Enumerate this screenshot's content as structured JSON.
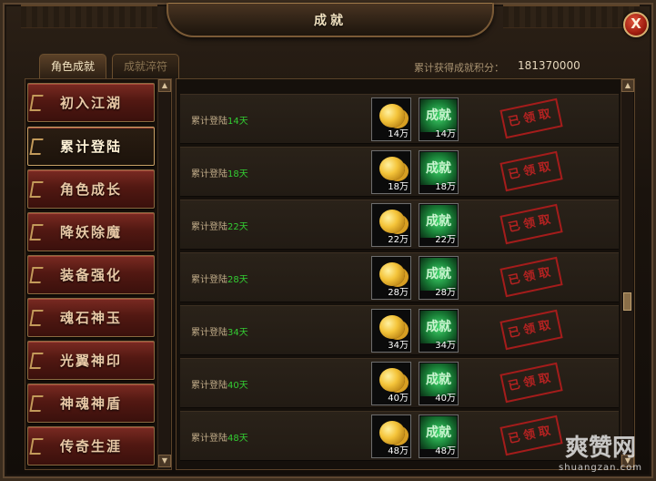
{
  "window": {
    "title": "成就"
  },
  "tabs": [
    {
      "label": "角色成就",
      "active": true
    },
    {
      "label": "成就淬符",
      "active": false
    }
  ],
  "points": {
    "label": "累计获得成就积分：",
    "value": "181370000"
  },
  "categories": [
    {
      "label": "初入江湖"
    },
    {
      "label": "累计登陆",
      "active": true
    },
    {
      "label": "角色成长"
    },
    {
      "label": "降妖除魔"
    },
    {
      "label": "装备强化"
    },
    {
      "label": "魂石神玉"
    },
    {
      "label": "光翼神印"
    },
    {
      "label": "神魂神盾"
    },
    {
      "label": "传奇生涯"
    }
  ],
  "rows": [
    {
      "prefix": "累计登陆",
      "num": "14天",
      "coin_qty": "14万",
      "badge": "成就",
      "badge_qty": "14万",
      "status": "已领取"
    },
    {
      "prefix": "累计登陆",
      "num": "18天",
      "coin_qty": "18万",
      "badge": "成就",
      "badge_qty": "18万",
      "status": "已领取"
    },
    {
      "prefix": "累计登陆",
      "num": "22天",
      "coin_qty": "22万",
      "badge": "成就",
      "badge_qty": "22万",
      "status": "已领取"
    },
    {
      "prefix": "累计登陆",
      "num": "28天",
      "coin_qty": "28万",
      "badge": "成就",
      "badge_qty": "28万",
      "status": "已领取"
    },
    {
      "prefix": "累计登陆",
      "num": "34天",
      "coin_qty": "34万",
      "badge": "成就",
      "badge_qty": "34万",
      "status": "已领取"
    },
    {
      "prefix": "累计登陆",
      "num": "40天",
      "coin_qty": "40万",
      "badge": "成就",
      "badge_qty": "40万",
      "status": "已领取"
    },
    {
      "prefix": "累计登陆",
      "num": "48天",
      "coin_qty": "48万",
      "badge": "成就",
      "badge_qty": "48万",
      "status": "已领取"
    }
  ],
  "close": {
    "icon": "close-x-icon",
    "glyph": "X"
  },
  "watermark": {
    "text": "爽赞网",
    "site": "shuangzan.com"
  },
  "icons": {
    "reward_1": "gold-coin-icon",
    "reward_2": "achievement-badge-icon"
  },
  "colors": {
    "accent_green": "#33cc33",
    "stamp_red": "#c42323"
  }
}
